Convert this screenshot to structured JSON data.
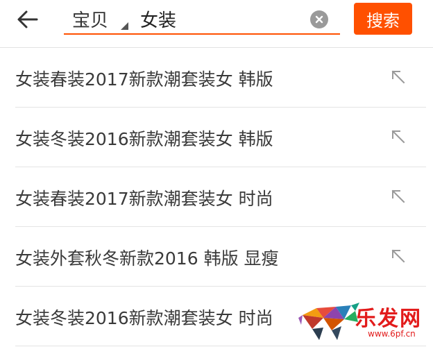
{
  "header": {
    "scope_label": "宝贝",
    "search_value": "女装",
    "search_button_label": "搜索"
  },
  "suggestions": [
    {
      "text": "女装春装2017新款潮套装女 韩版"
    },
    {
      "text": "女装冬装2016新款潮套装女 韩版"
    },
    {
      "text": "女装春装2017新款潮套装女 时尚"
    },
    {
      "text": "女装外套秋冬新款2016 韩版 显瘦"
    },
    {
      "text": "女装冬装2016新款潮套装女 时尚"
    }
  ],
  "watermark": {
    "logo_text": "乐发网",
    "url": "www.6pf.cn"
  },
  "colors": {
    "accent": "#ff5000",
    "watermark": "#e21b1b"
  },
  "icons": {
    "back": "arrow-left-icon",
    "clear": "clear-icon",
    "fill": "arrow-up-left-icon"
  }
}
